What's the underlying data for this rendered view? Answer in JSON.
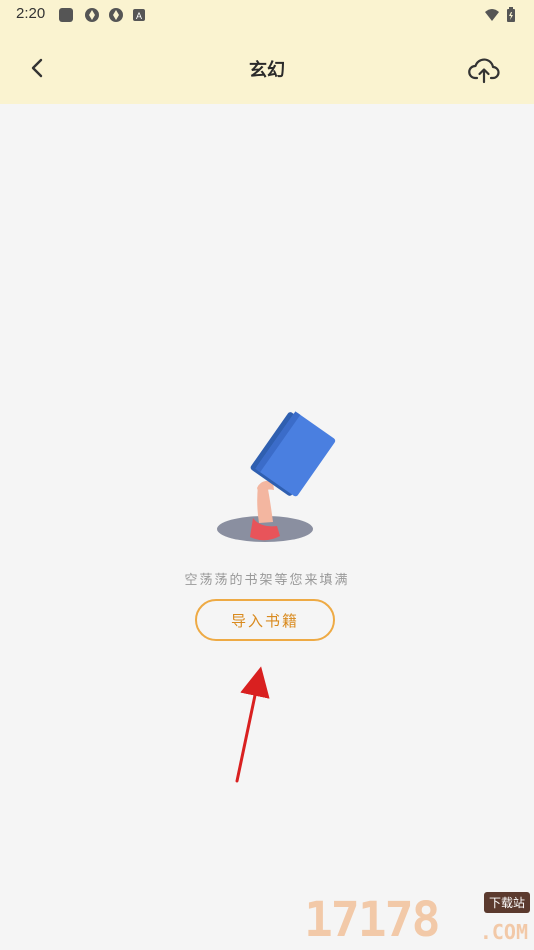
{
  "status_bar": {
    "time": "2:20",
    "icons": [
      "square-icon",
      "clover-icon",
      "clover-icon",
      "a-box-icon"
    ],
    "right_icons": [
      "wifi-icon",
      "battery-icon"
    ]
  },
  "header": {
    "title": "玄幻",
    "back_icon": "chevron-left-icon",
    "upload_icon": "cloud-upload-icon",
    "background": "#faf3d0"
  },
  "empty_state": {
    "illustration": "hand-holding-book",
    "message": "空荡荡的书架等您来填满",
    "button_label": "导入书籍",
    "accent": "#eeaa44"
  },
  "watermark": {
    "text": "17178",
    "badge": "下载站",
    "suffix": ".COM"
  }
}
